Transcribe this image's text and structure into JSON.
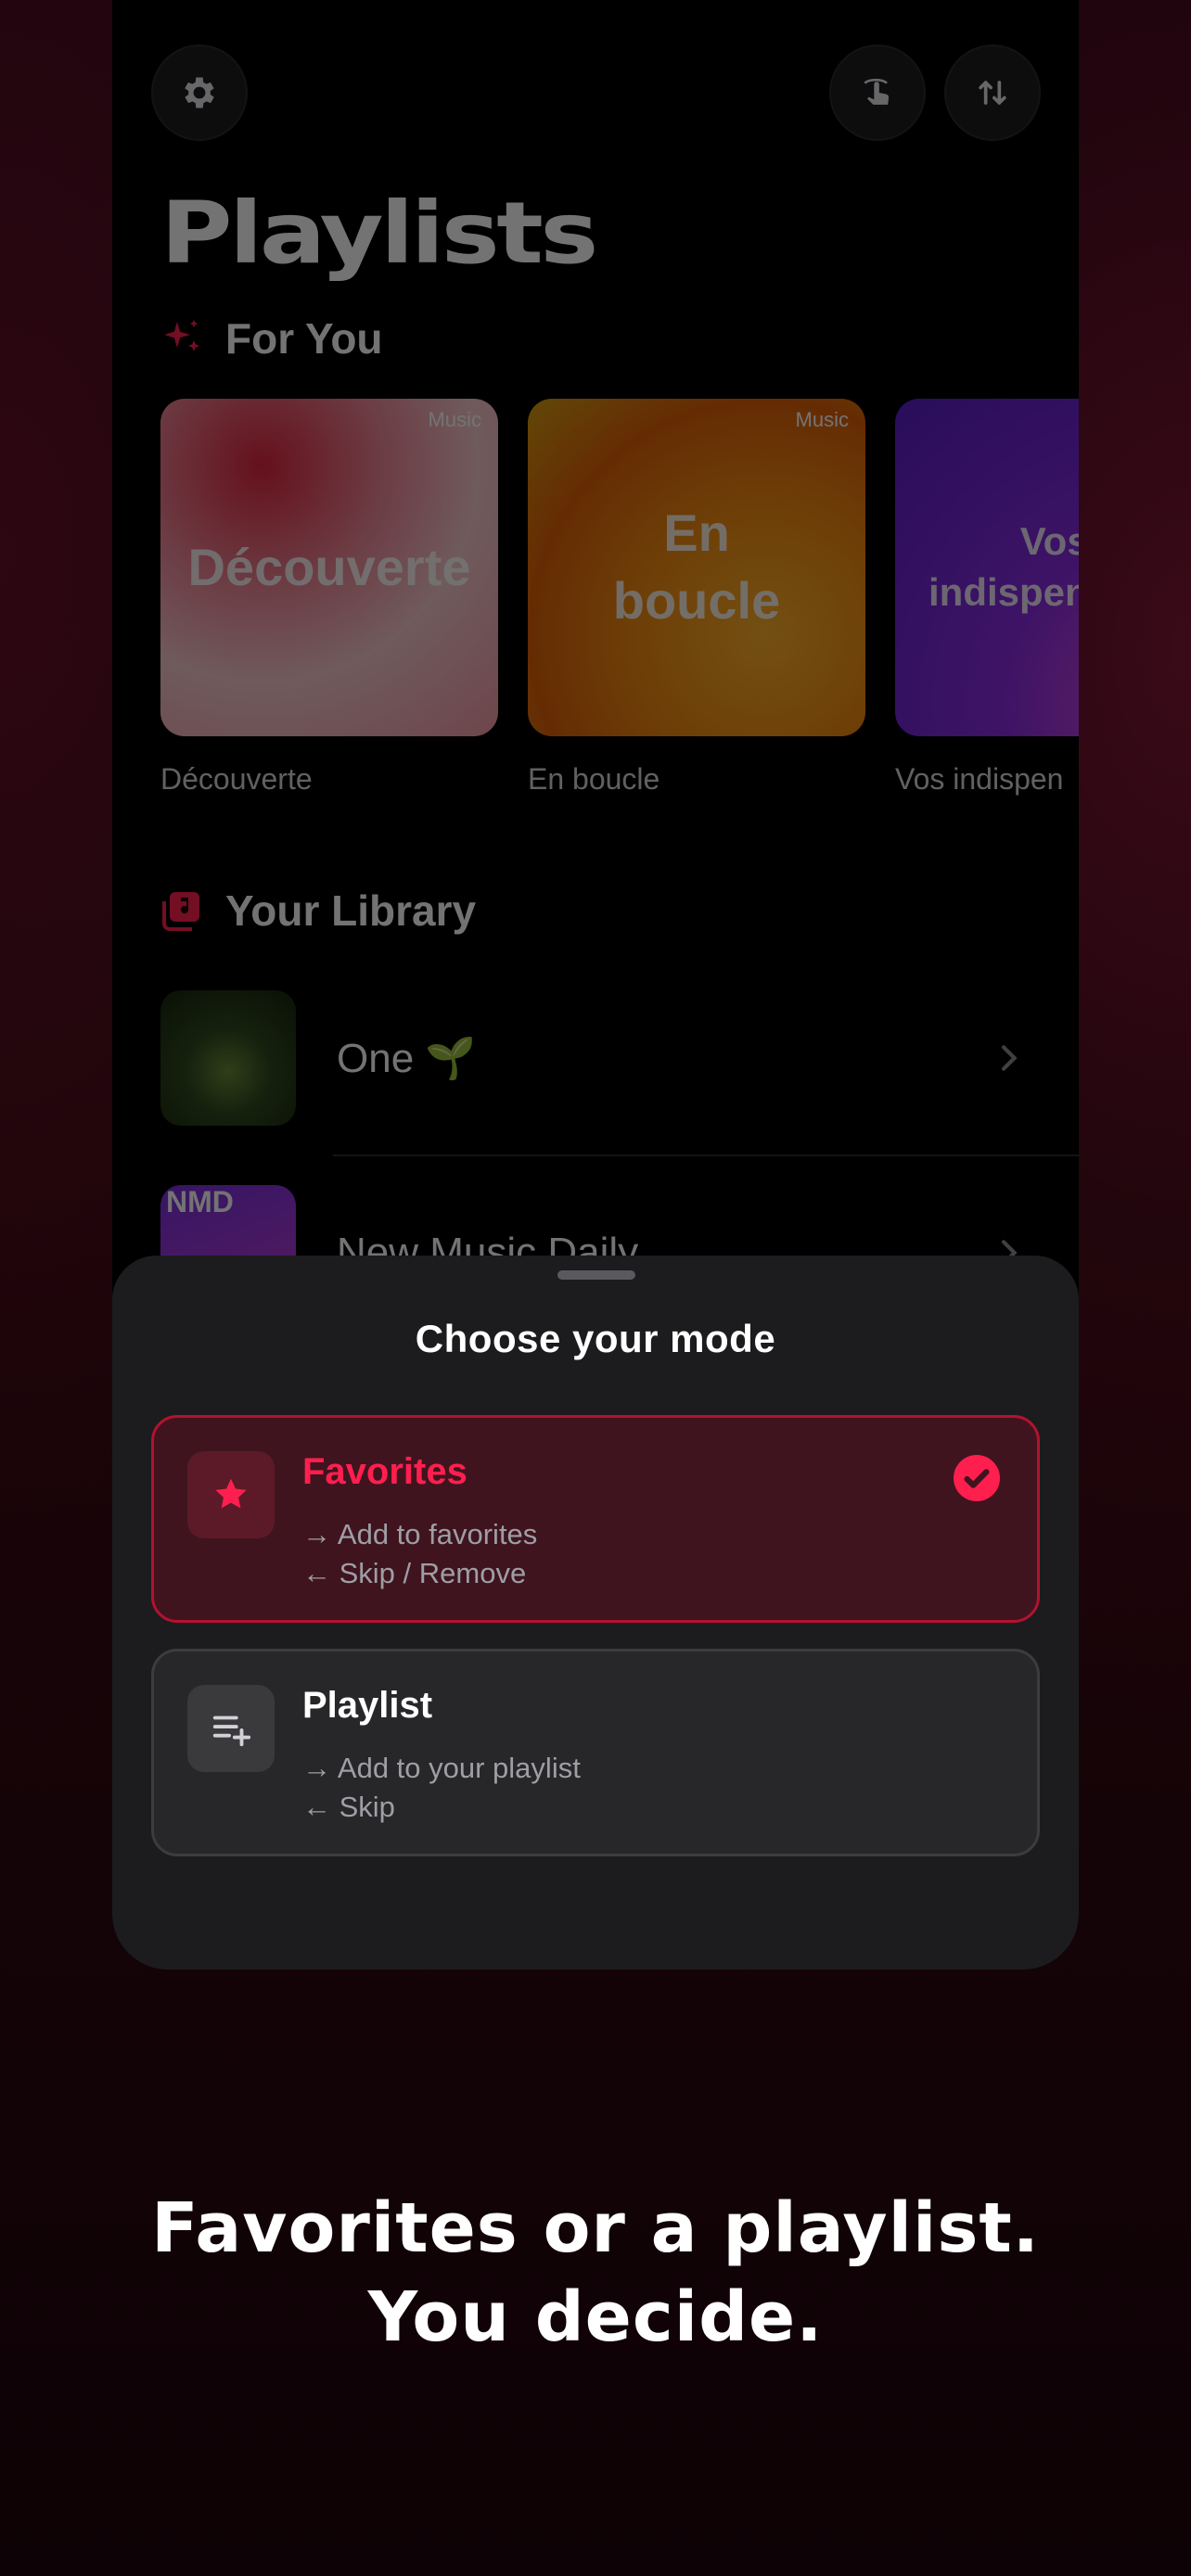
{
  "colors": {
    "accent": "#ff1f4f",
    "sheet": "#1c1c1e",
    "background": "#120308"
  },
  "header": {
    "settings_icon": "gear-icon",
    "gesture_icon": "swipe-hand-icon",
    "sort_icon": "sort-arrows-icon",
    "title": "Playlists"
  },
  "for_you": {
    "label": "For You",
    "icon": "sparkles-icon",
    "cards": [
      {
        "art_text": "Découverte",
        "badge": "Music",
        "caption": "Découverte"
      },
      {
        "art_text": "En\nboucle",
        "badge": "Music",
        "caption": "En boucle"
      },
      {
        "art_text": "Vos\nindispen",
        "badge": "",
        "caption": "Vos indispen"
      }
    ]
  },
  "library": {
    "label": "Your Library",
    "icon": "music-library-icon",
    "items": [
      {
        "title": "One 🌱"
      },
      {
        "title": "New Music Daily",
        "thumb_text": "NMD"
      }
    ]
  },
  "sheet": {
    "title": "Choose your mode",
    "modes": [
      {
        "name": "Favorites",
        "icon": "star-icon",
        "line1": "→ Add to favorites",
        "line2": "← Skip / Remove",
        "selected": true
      },
      {
        "name": "Playlist",
        "icon": "playlist-add-icon",
        "line1": "→ Add to your playlist",
        "line2": "← Skip",
        "selected": false
      }
    ]
  },
  "tagline": {
    "line1": "Favorites or a playlist.",
    "line2": "You decide."
  }
}
